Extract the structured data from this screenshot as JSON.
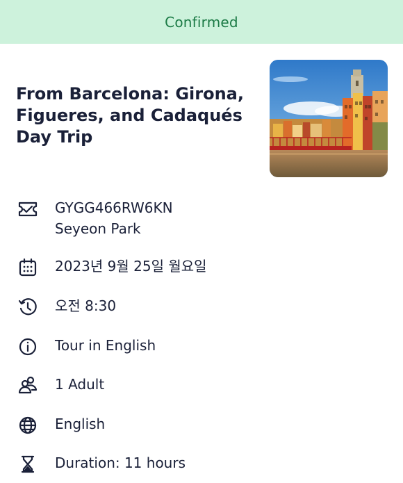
{
  "status": {
    "label": "Confirmed",
    "color": "#1b7a45",
    "background": "#cdf2dc"
  },
  "booking": {
    "title_line1": "From Barcelona: Girona,",
    "title_line2": "Figueres, and Cadaqués",
    "title_line3": "Day Trip",
    "image_alt": "Colorful riverside houses of Girona with a red bridge"
  },
  "details": {
    "reference": {
      "icon": "ticket-icon",
      "code": "GYGG466RW6KN",
      "name": "Seyeon Park"
    },
    "date": {
      "icon": "calendar-icon",
      "value": "2023년 9월 25일 월요일"
    },
    "time": {
      "icon": "clock-history-icon",
      "value": "오전 8:30"
    },
    "option": {
      "icon": "info-icon",
      "value": "Tour in English"
    },
    "participants": {
      "icon": "people-icon",
      "value": "1 Adult"
    },
    "language": {
      "icon": "globe-icon",
      "value": "English"
    },
    "duration": {
      "icon": "hourglass-icon",
      "value": "Duration: 11 hours"
    }
  }
}
